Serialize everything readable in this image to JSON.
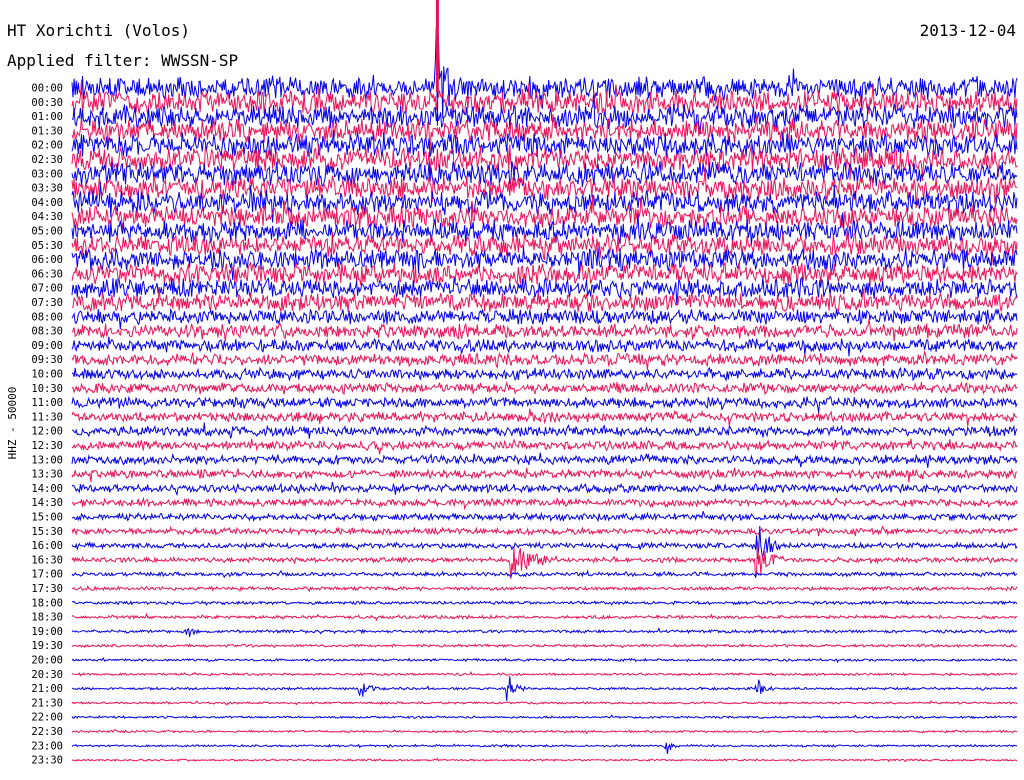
{
  "header": {
    "station": "HT Xorichti (Volos)",
    "date": "2013-12-04",
    "filter": "Applied filter: WWSSN-SP"
  },
  "chart_data": {
    "type": "line",
    "ylabel": "HHZ - 50000",
    "row_labels": [
      "00:00",
      "00:30",
      "01:00",
      "01:30",
      "02:00",
      "02:30",
      "03:00",
      "03:30",
      "04:00",
      "04:30",
      "05:00",
      "05:30",
      "06:00",
      "06:30",
      "07:00",
      "07:30",
      "08:00",
      "08:30",
      "09:00",
      "09:30",
      "10:00",
      "10:30",
      "11:00",
      "11:30",
      "12:00",
      "12:30",
      "13:00",
      "13:30",
      "14:00",
      "14:30",
      "15:00",
      "15:30",
      "16:00",
      "16:30",
      "17:00",
      "17:30",
      "18:00",
      "18:30",
      "19:00",
      "19:30",
      "20:00",
      "20:30",
      "21:00",
      "21:30",
      "22:00",
      "22:30",
      "23:00",
      "23:30"
    ],
    "colors": [
      "#0000ee",
      "#ee1155"
    ],
    "noise_levels": [
      0.85,
      0.85,
      0.85,
      0.85,
      0.85,
      0.85,
      0.85,
      0.85,
      0.82,
      0.82,
      0.8,
      0.8,
      0.8,
      0.78,
      0.72,
      0.65,
      0.55,
      0.5,
      0.47,
      0.45,
      0.42,
      0.4,
      0.4,
      0.38,
      0.36,
      0.34,
      0.34,
      0.32,
      0.3,
      0.28,
      0.25,
      0.22,
      0.2,
      0.18,
      0.15,
      0.13,
      0.12,
      0.12,
      0.11,
      0.1,
      0.09,
      0.09,
      0.09,
      0.08,
      0.08,
      0.08,
      0.08,
      0.07
    ],
    "events": [
      {
        "row": 0,
        "minute": 11.6,
        "amp": 3.5,
        "dur": 0.6,
        "note": "large spike at 00:00 crossing top"
      },
      {
        "row": 33,
        "minute": 14.0,
        "amp": 1.3,
        "dur": 1.5
      },
      {
        "row": 32,
        "minute": 21.8,
        "amp": 1.5,
        "dur": 0.8
      },
      {
        "row": 33,
        "minute": 21.8,
        "amp": 1.2,
        "dur": 0.8
      },
      {
        "row": 42,
        "minute": 9.2,
        "amp": 0.7,
        "dur": 0.6
      },
      {
        "row": 42,
        "minute": 13.9,
        "amp": 0.8,
        "dur": 0.5
      },
      {
        "row": 42,
        "minute": 21.8,
        "amp": 0.7,
        "dur": 0.5
      },
      {
        "row": 38,
        "minute": 3.7,
        "amp": 0.5,
        "dur": 0.4
      },
      {
        "row": 46,
        "minute": 18.9,
        "amp": 0.6,
        "dur": 0.3
      }
    ]
  }
}
